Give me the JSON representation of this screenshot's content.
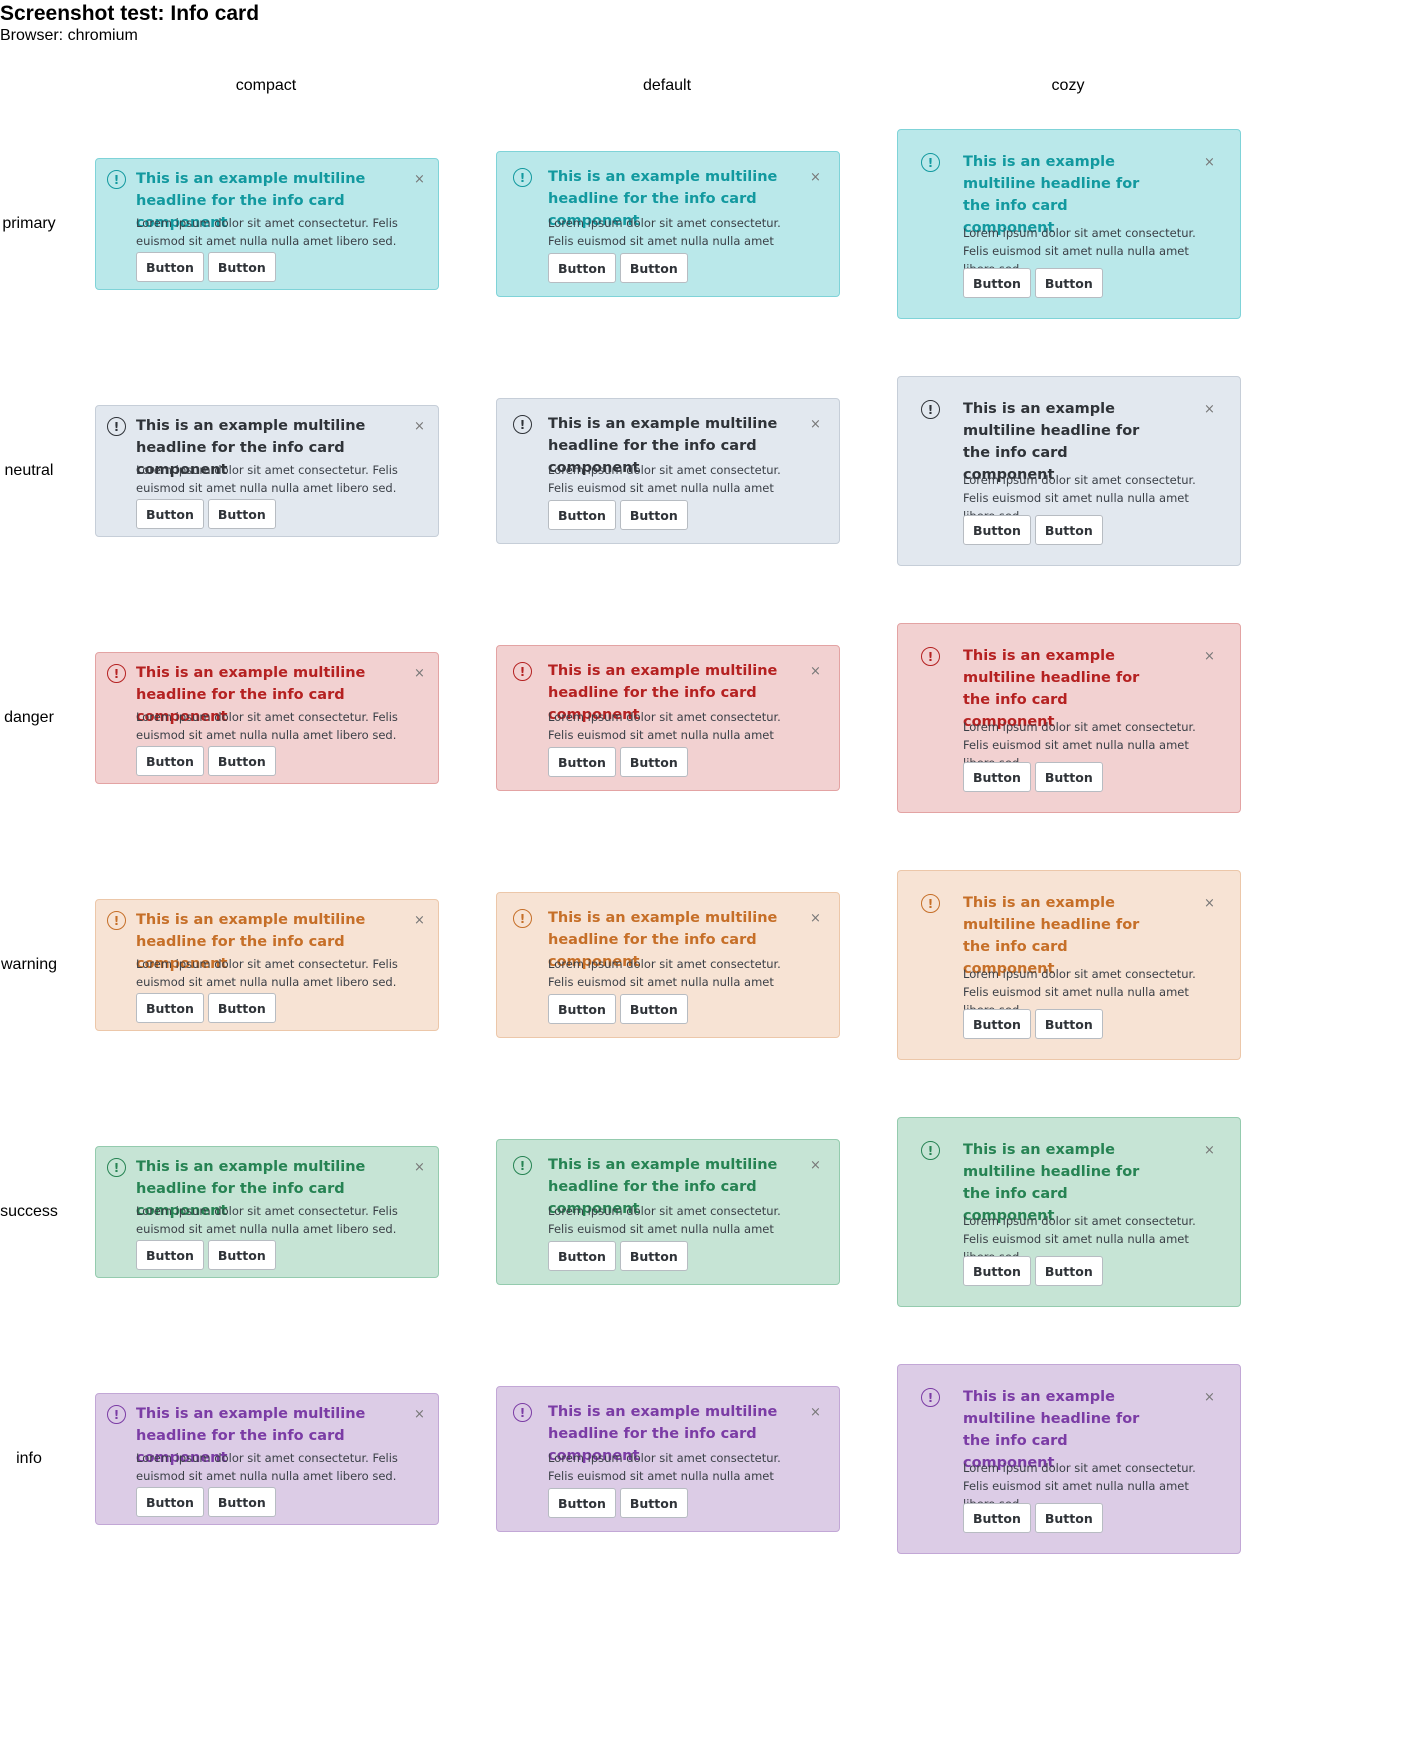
{
  "page": {
    "title": "Screenshot test: Info card",
    "browser": "Browser: chromium"
  },
  "columns": [
    "compact",
    "default",
    "cozy"
  ],
  "rows": [
    {
      "key": "primary",
      "label": "primary",
      "bg": "#bae8ea",
      "border": "#7fd3d8",
      "fg": "#12999f"
    },
    {
      "key": "neutral",
      "label": "neutral",
      "bg": "#e2e8ef",
      "border": "#c6ced8",
      "fg": "#2f3338"
    },
    {
      "key": "danger",
      "label": "danger",
      "bg": "#f2d1d1",
      "border": "#e3a3a3",
      "fg": "#b52121"
    },
    {
      "key": "warning",
      "label": "warning",
      "bg": "#f7e3d4",
      "border": "#ecc7a9",
      "fg": "#c66f28"
    },
    {
      "key": "success",
      "label": "success",
      "bg": "#c6e4d5",
      "border": "#94cbae",
      "fg": "#268353"
    },
    {
      "key": "info",
      "label": "info",
      "bg": "#dccce6",
      "border": "#c2a7d6",
      "fg": "#7b3ca5"
    }
  ],
  "card": {
    "headline": "This is an example multiline headline for the info card component",
    "body": "Lorem ipsum dolor sit amet consectetur. Felis euismod sit amet nulla nulla amet libero sed.",
    "button_1": "Button",
    "button_2": "Button",
    "close_glyph": "×",
    "icon": "exclamation-circle-icon",
    "icon_glyph": "!"
  }
}
